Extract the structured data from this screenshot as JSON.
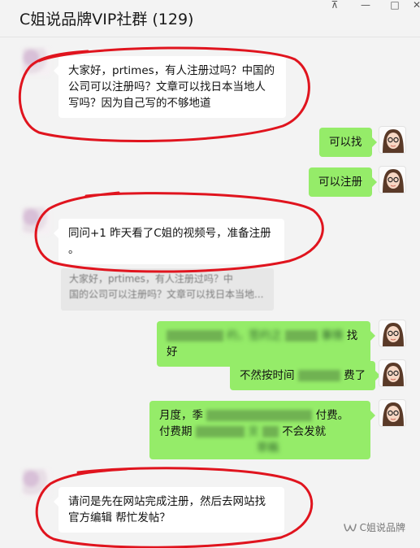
{
  "window": {
    "title": "C姐说品牌VIP社群 (129)",
    "controls": {
      "pin": "⊼",
      "minimize": "—",
      "maximize": "□",
      "close": "✕"
    }
  },
  "messages": [
    {
      "side": "in",
      "lines": [
        "大家好，prtimes，有人注册过吗？中国的",
        "公司可以注册吗？文章可以找日本当地人",
        "写吗？因为自己写的不够地道"
      ]
    },
    {
      "side": "out",
      "text": "可以找"
    },
    {
      "side": "out",
      "text": "可以注册"
    },
    {
      "side": "in",
      "lines": [
        "同问+1 昨天看了C姐的视频号，准备注册",
        "。"
      ]
    },
    {
      "side": "quote",
      "lines": [
        "大家好，prtimes，有人注册过吗？中",
        "国的公司可以注册吗？文章可以找日本当地..."
      ]
    },
    {
      "side": "out",
      "text_parts": [
        "约，签约之",
        "事情",
        "找好"
      ]
    },
    {
      "side": "out",
      "text_parts": [
        "不然按时间",
        "费了"
      ]
    },
    {
      "side": "out",
      "lines": [
        "月度，季",
        "付费。",
        "付费期",
        "文",
        "不会发就",
        "草稿"
      ]
    },
    {
      "side": "in",
      "lines": [
        "请问是先在网站完成注册，然后去网站找",
        "官方编辑 帮忙发帖？"
      ]
    }
  ],
  "watermark": {
    "text": "C姐说品牌"
  },
  "colors": {
    "out_bubble": "#95ec69",
    "in_bubble": "#ffffff",
    "annotation": "#e0141e",
    "background": "#f3f3f3"
  }
}
